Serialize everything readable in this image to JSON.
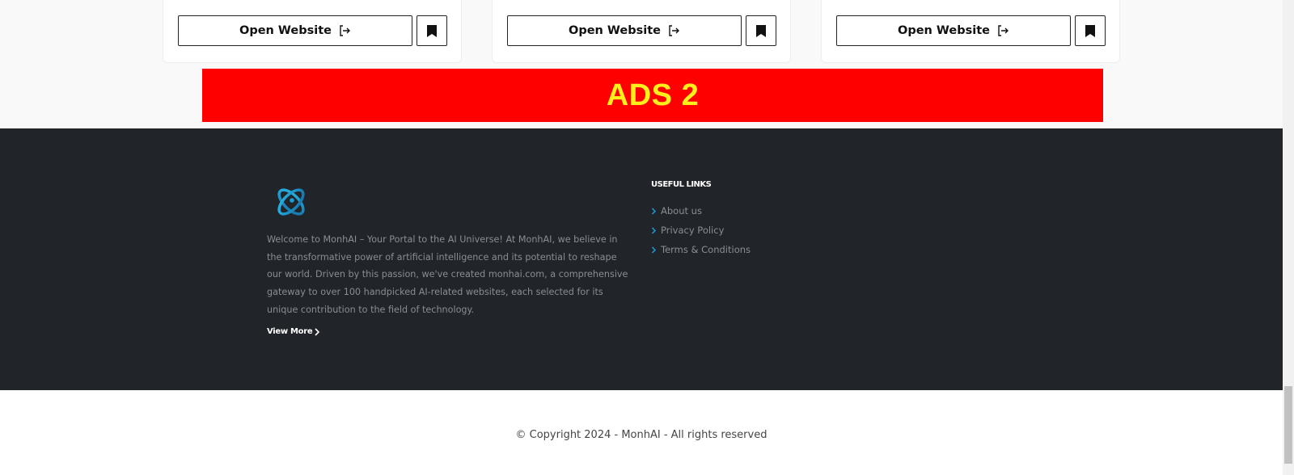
{
  "cards": [
    {
      "open_label": "Open Website",
      "open_icon": "external-link-icon",
      "bookmark_icon": "bookmark-icon"
    },
    {
      "open_label": "Open Website",
      "open_icon": "external-link-icon",
      "bookmark_icon": "bookmark-icon"
    },
    {
      "open_label": "Open Website",
      "open_icon": "external-link-icon",
      "bookmark_icon": "bookmark-icon"
    }
  ],
  "ads": {
    "text": "ADS 2",
    "background": "#ff0000",
    "text_color": "#ffef1a"
  },
  "footer": {
    "about": "Welcome to MonhAI – Your Portal to the AI Universe! At MonhAI, we believe in the transformative power of artificial intelligence and its potential to reshape our world. Driven by this passion, we've created monhai.com, a comprehensive gateway to over 100 handpicked AI-related websites, each selected for its unique contribution to the field of technology.",
    "view_more": "View More",
    "links_title": "USEFUL LINKS",
    "links": [
      "About us",
      "Privacy Policy",
      "Terms & Conditions"
    ],
    "background": "#212428",
    "accent": "#1a9fd9"
  },
  "copyright": "© Copyright 2024 - MonhAI - All rights reserved"
}
